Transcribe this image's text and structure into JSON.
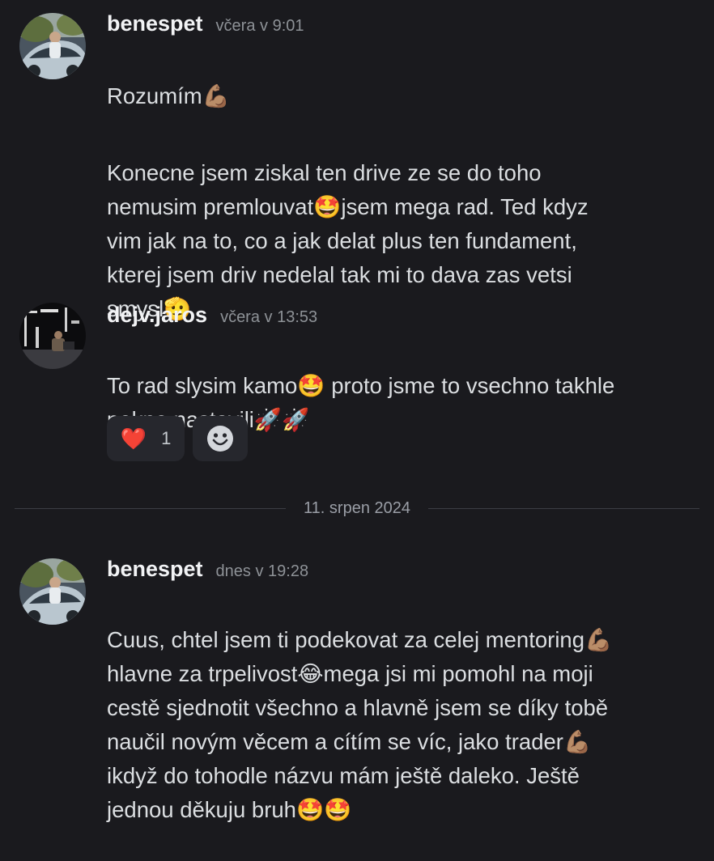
{
  "messages": [
    {
      "author": "benespet",
      "timestamp": "včera v 9:01",
      "paragraphs": [
        "Rozumím💪🏽",
        "Konecne jsem ziskal ten drive ze se do toho\nnemusim premlouvat🤩jsem mega rad. Ted kdyz\nvim jak na to, co a jak delat plus ten fundament,\nkterej jsem driv nedelal tak mi to dava zas vetsi\nsmysl🫡"
      ]
    },
    {
      "author": "dejv.jaros",
      "timestamp": "včera v 13:53",
      "paragraphs": [
        "To rad slysim kamo🤩 proto jsme to vsechno takhle\npekne nastavili🚀🚀"
      ],
      "reactions": [
        {
          "emoji": "❤️",
          "count": "1"
        }
      ],
      "add_reaction_icon": "smiley-face-icon"
    },
    {
      "author": "benespet",
      "timestamp": "dnes v 19:28",
      "paragraphs": [
        "Cuus, chtel jsem ti podekovat za celej mentoring💪🏽\nhlavne za trpelivost😂mega jsi mi pomohl na moji\ncestě sjednotit všechno a hlavně jsem se díky tobě\nnaučil novým věcem a cítím se víc, jako trader💪🏽\nikdyž do tohodle názvu mám ještě daleko. Ještě\njednou děkuju bruh🤩🤩"
      ]
    }
  ],
  "date_divider": "11. srpen 2024",
  "colors": {
    "background": "#1a1a1e",
    "author": "#f2f3f5",
    "text": "#dbdee1",
    "timestamp": "#8e9297",
    "reaction_bg": "#26272d"
  }
}
